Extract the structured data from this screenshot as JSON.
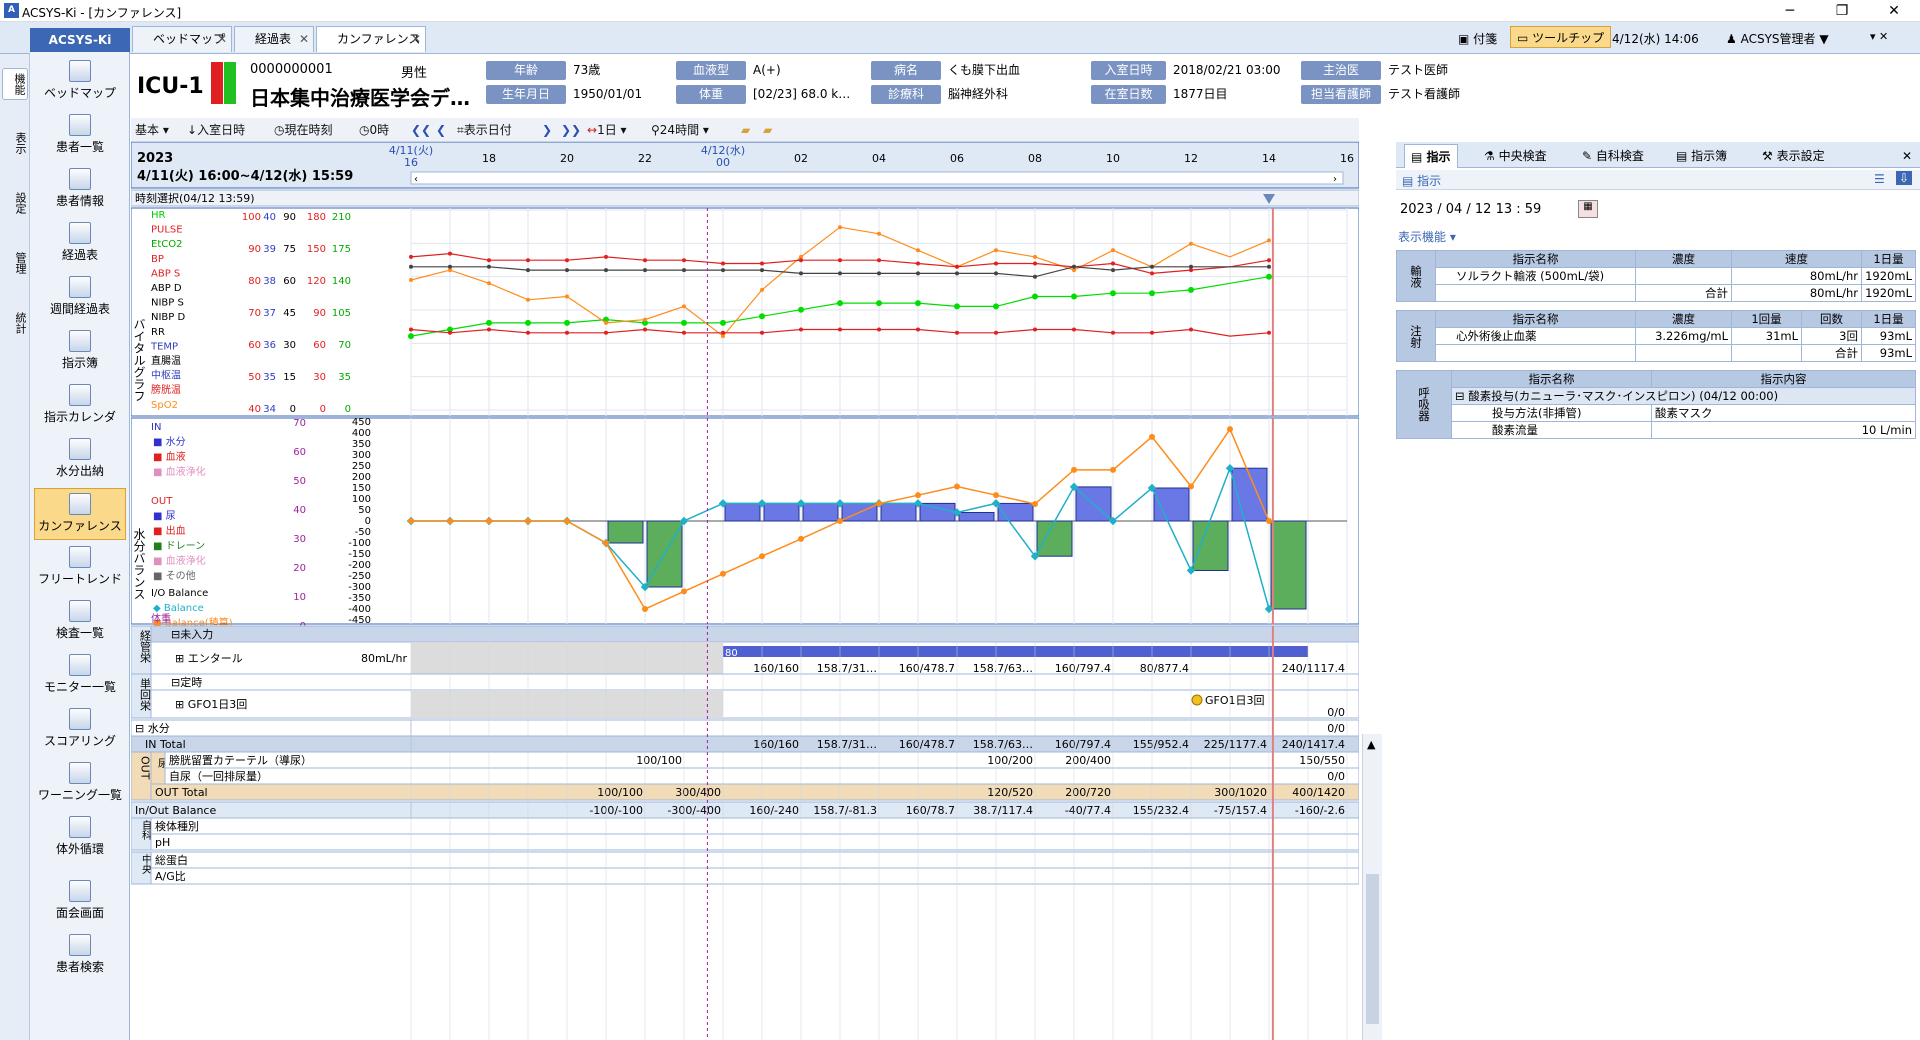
{
  "window": {
    "title": "ACSYS-Ki - [カンファレンス]",
    "app_icon": "ACSYS-logo",
    "controls": [
      "─",
      "❐",
      "✕"
    ]
  },
  "tabs": [
    {
      "label": "ベッドマップ"
    },
    {
      "label": "経過表"
    },
    {
      "label": "カンファレンス",
      "active": true
    }
  ],
  "header_right": {
    "notes": "付箋",
    "tooltip": "ツールチップ",
    "datetime": "4/12(水) 14:06",
    "user": "ACSYS管理者 ▼"
  },
  "left_rail": [
    "機能",
    "表示",
    "設定",
    "管理",
    "統計"
  ],
  "sidebar": {
    "title": "ACSYS-Ki",
    "items": [
      {
        "label": "ベッドマップ",
        "icon": "bed-icon"
      },
      {
        "label": "患者一覧",
        "icon": "patient-list-icon"
      },
      {
        "label": "患者情報",
        "icon": "patient-info-icon"
      },
      {
        "label": "経過表",
        "icon": "chart-icon"
      },
      {
        "label": "週間経過表",
        "icon": "weekly-chart-icon"
      },
      {
        "label": "指示簿",
        "icon": "order-book-icon"
      },
      {
        "label": "指示カレンダ",
        "icon": "order-calendar-icon"
      },
      {
        "label": "水分出納",
        "icon": "fluid-balance-icon"
      },
      {
        "label": "カンファレンス",
        "icon": "conference-icon",
        "active": true
      },
      {
        "label": "フリートレンド",
        "icon": "free-trend-icon"
      },
      {
        "label": "検査一覧",
        "icon": "lab-list-icon"
      },
      {
        "label": "モニター一覧",
        "icon": "monitor-list-icon"
      },
      {
        "label": "スコアリング",
        "icon": "scoring-icon"
      },
      {
        "label": "ワーニング一覧",
        "icon": "warning-list-icon"
      },
      {
        "label": "体外循環",
        "icon": "ecmo-icon"
      },
      {
        "label": "面会画面",
        "icon": "visit-icon"
      },
      {
        "label": "患者検索",
        "icon": "search-icon"
      }
    ]
  },
  "patient": {
    "bed": "ICU-1",
    "id": "0000000001",
    "name": "日本集中治療医学会デ…",
    "sex": "男性",
    "age_label": "年齢",
    "age": "73歳",
    "dob_label": "生年月日",
    "dob": "1950/01/01",
    "blood_label": "血液型",
    "blood": "A(+)",
    "weight_label": "体重",
    "weight": "[02/23] 68.0 k…",
    "dx_label": "病名",
    "dx": "くも膜下出血",
    "dept_label": "診療科",
    "dept": "脳神経外科",
    "admit_label": "入室日時",
    "admit": "2018/02/21 03:00",
    "stay_label": "在室日数",
    "stay": "1877日目",
    "doctor_label": "主治医",
    "doctor": "テスト医師",
    "nurse_label": "担当看護師",
    "nurse": "テスト看護師"
  },
  "toolbar": {
    "basic": "基本",
    "admit_time": "入室日時",
    "now": "現在時刻",
    "zero": "0時",
    "display_date": "表示日付",
    "one_day": "1日",
    "range": "24時間"
  },
  "timeline": {
    "year": "2023",
    "range": "4/11(火) 16:00~4/12(水) 15:59",
    "day1": "4/11(火)",
    "day1_hour": "16",
    "day2": "4/12(水)",
    "day2_hour": "00",
    "hours": [
      "18",
      "20",
      "22",
      "02",
      "04",
      "06",
      "08",
      "10",
      "12",
      "14",
      "16"
    ],
    "select": "時刻選択(04/12 13:59)"
  },
  "vitals": {
    "title": "バイタルグラフ",
    "legend": [
      "HR",
      "PULSE",
      "EtCO2",
      "BP",
      "ABP S",
      "ABP D",
      "NIBP S",
      "NIBP D",
      "RR",
      "TEMP",
      "直腸温",
      "中枢温",
      "膀胱温",
      "SpO2"
    ],
    "scale_cols": [
      [
        "100",
        "90",
        "80",
        "70",
        "60",
        "50",
        "40"
      ],
      [
        "40",
        "39",
        "38",
        "37",
        "36",
        "35",
        "34"
      ],
      [
        "90",
        "75",
        "60",
        "45",
        "30",
        "15",
        "0"
      ],
      [
        "180",
        "150",
        "120",
        "90",
        "60",
        "30",
        "0"
      ],
      [
        "210",
        "175",
        "140",
        "105",
        "70",
        "35",
        "0"
      ]
    ]
  },
  "fluid": {
    "title": "水分バランス",
    "legend_in": "IN",
    "in_items": [
      "水分",
      "血液",
      "血液浄化"
    ],
    "legend_out": "OUT",
    "out_items": [
      "尿",
      "出血",
      "ドレーン",
      "血液浄化",
      "その他"
    ],
    "io": "I/O Balance",
    "io_items": [
      "Balance",
      "Balance(積算)"
    ],
    "weight": "体重",
    "left_scale": [
      "70",
      "60",
      "50",
      "40",
      "30",
      "20",
      "10",
      "0"
    ],
    "right_scale": [
      "450",
      "400",
      "350",
      "300",
      "250",
      "200",
      "150",
      "100",
      "50",
      "0",
      "-50",
      "-100",
      "-150",
      "-200",
      "-250",
      "-300",
      "-350",
      "-400",
      "-450"
    ]
  },
  "chart_data": [
    {
      "type": "line",
      "title": "バイタルグラフ",
      "x": [
        "16:00",
        "17:00",
        "18:00",
        "19:00",
        "20:00",
        "21:00",
        "22:00",
        "23:00",
        "00:00",
        "01:00",
        "02:00",
        "03:00",
        "04:00",
        "05:00",
        "06:00",
        "07:00",
        "08:00",
        "09:00",
        "10:00",
        "11:00",
        "12:00",
        "13:00",
        "14:00"
      ],
      "series": [
        {
          "name": "HR",
          "values": [
            58,
            60,
            62,
            62,
            62,
            63,
            62,
            62,
            62,
            64,
            66,
            68,
            68,
            68,
            67,
            67,
            70,
            70,
            71,
            71,
            72,
            74,
            76
          ]
        },
        {
          "name": "EtCO2",
          "values": [
            75,
            78,
            74,
            69,
            70,
            62,
            63,
            67,
            58,
            72,
            82,
            91,
            89,
            84,
            79,
            84,
            82,
            78,
            84,
            79,
            86,
            82,
            87
          ]
        },
        {
          "name": "ABP S",
          "values": [
            82,
            83,
            81,
            81,
            81,
            82,
            81,
            81,
            80,
            80,
            81,
            81,
            81,
            80,
            79,
            80,
            80,
            79,
            80,
            77,
            78,
            79,
            81
          ]
        },
        {
          "name": "NIBP S",
          "values": [
            79,
            79,
            79,
            78,
            78,
            78,
            78,
            78,
            78,
            78,
            77,
            77,
            77,
            77,
            77,
            77,
            76,
            79,
            78,
            79,
            79,
            79,
            79
          ]
        },
        {
          "name": "ABP D",
          "values": [
            60,
            59,
            60,
            59,
            59,
            59,
            60,
            59,
            59,
            59,
            60,
            60,
            60,
            60,
            59,
            59,
            60,
            60,
            59,
            59,
            60,
            58,
            59
          ]
        }
      ]
    },
    {
      "type": "bar",
      "title": "水分バランス",
      "x": [
        "16:00",
        "17:00",
        "18:00",
        "19:00",
        "20:00",
        "21:00",
        "22:00",
        "23:00",
        "00:00",
        "01:00",
        "02:00",
        "03:00",
        "04:00",
        "05:00",
        "06:00",
        "07:00",
        "08:00",
        "09:00",
        "10:00",
        "11:00",
        "12:00",
        "13:00",
        "14:00"
      ],
      "series": [
        {
          "name": "Balance",
          "values": [
            0,
            0,
            0,
            0,
            0,
            -100,
            -300,
            0,
            80,
            80,
            80,
            80,
            80,
            80,
            38.7,
            80,
            -160,
            155,
            0,
            150,
            -225,
            240,
            -400
          ]
        },
        {
          "name": "Balance(積算)",
          "values": [
            0,
            0,
            0,
            0,
            0,
            -100,
            -400,
            -320,
            -240,
            -160,
            -81.3,
            0,
            78.7,
            117.4,
            157,
            117.4,
            77.4,
            232.4,
            232.4,
            382.4,
            157.4,
            417.4,
            0
          ]
        }
      ]
    }
  ],
  "flow": {
    "section1": "経管栄",
    "group1": "未入力",
    "enteral": "エンタール",
    "enteral_rate": "80mL/hr",
    "enteral_start": "80",
    "enteral_vals": [
      "160/160",
      "158.7/31…",
      "160/478.7",
      "158.7/63…",
      "160/797.4",
      "80/877.4",
      "240/1117.4"
    ],
    "section2": "単回栄",
    "group2": "定時",
    "gfo": "GFO1日3回",
    "gfo_marker": "GFO1日3回",
    "gfo_total": "0/0",
    "water": "水分",
    "water_total": "0/0",
    "in_total": "IN Total",
    "in_vals": [
      "160/160",
      "158.7/31…",
      "160/478.7",
      "158.7/63…",
      "160/797.4",
      "155/952.4",
      "225/1177.4",
      "240/1417.4"
    ],
    "out_section": "OUT",
    "out_sub": "尿",
    "cath": "膀胱留置カテーテル（導尿）",
    "cath_vals": [
      "100/100",
      "100/200",
      "200/400",
      "150/550"
    ],
    "self_urine": "自尿（一回排尿量）",
    "self_total": "0/0",
    "out_total": "OUT Total",
    "out_vals": [
      "100/100",
      "300/400",
      "120/520",
      "200/720",
      "300/1020",
      "400/1420"
    ],
    "balance": "In/Out Balance",
    "balance_vals": [
      "-100/-100",
      "-300/-400",
      "160/-240",
      "158.7/-81.3",
      "160/78.7",
      "38.7/117.4",
      "-40/77.4",
      "155/232.4",
      "-75/157.4",
      "-160/-2.6"
    ],
    "lab1_side": "自科",
    "lab1": [
      "検体種別",
      "pH"
    ],
    "lab2_side": "中央",
    "lab2": [
      "総蛋白",
      "A/G比"
    ]
  },
  "right_panel": {
    "tabs": [
      "指示",
      "中央検査",
      "自科検査",
      "指示簿",
      "表示設定"
    ],
    "section": "指示",
    "date": "2023 / 04 / 12   13 : 59",
    "func": "表示機能 ▾",
    "infusion": {
      "side": "輸液",
      "headers": [
        "指示名称",
        "濃度",
        "速度",
        "1日量"
      ],
      "row": [
        "ソルラクト輸液 (500mL/袋)",
        "",
        "80mL/hr",
        "1920mL"
      ],
      "total_label": "合計",
      "total_rate": "80mL/hr",
      "total_day": "1920mL"
    },
    "injection": {
      "side": "注射",
      "headers": [
        "指示名称",
        "濃度",
        "1回量",
        "回数",
        "1日量"
      ],
      "row": [
        "心外術後止血薬",
        "3.226mg/mL",
        "31mL",
        "3回",
        "93mL"
      ],
      "total_label": "合計",
      "total_day": "93mL"
    },
    "resp": {
      "side": "呼吸器",
      "headers": [
        "指示名称",
        "指示内容"
      ],
      "order": "⊟ 酸素投与(カニューラ･マスク･インスピロン) (04/12 00:00)",
      "r1": [
        "投与方法(非挿管)",
        "酸素マスク"
      ],
      "r2": [
        "酸素流量",
        "10 L/min"
      ]
    }
  },
  "colors": {
    "accent": "#3b67b4",
    "label_bg": "#7a93c2",
    "active_tab": "#fbd98a",
    "hr": "#00cc00",
    "abp": "#e02020",
    "etco2": "#ff8c1a",
    "io_bal": "#20b0c8",
    "urine": "#3030d0",
    "blood": "#e04040",
    "drain": "#208020"
  }
}
